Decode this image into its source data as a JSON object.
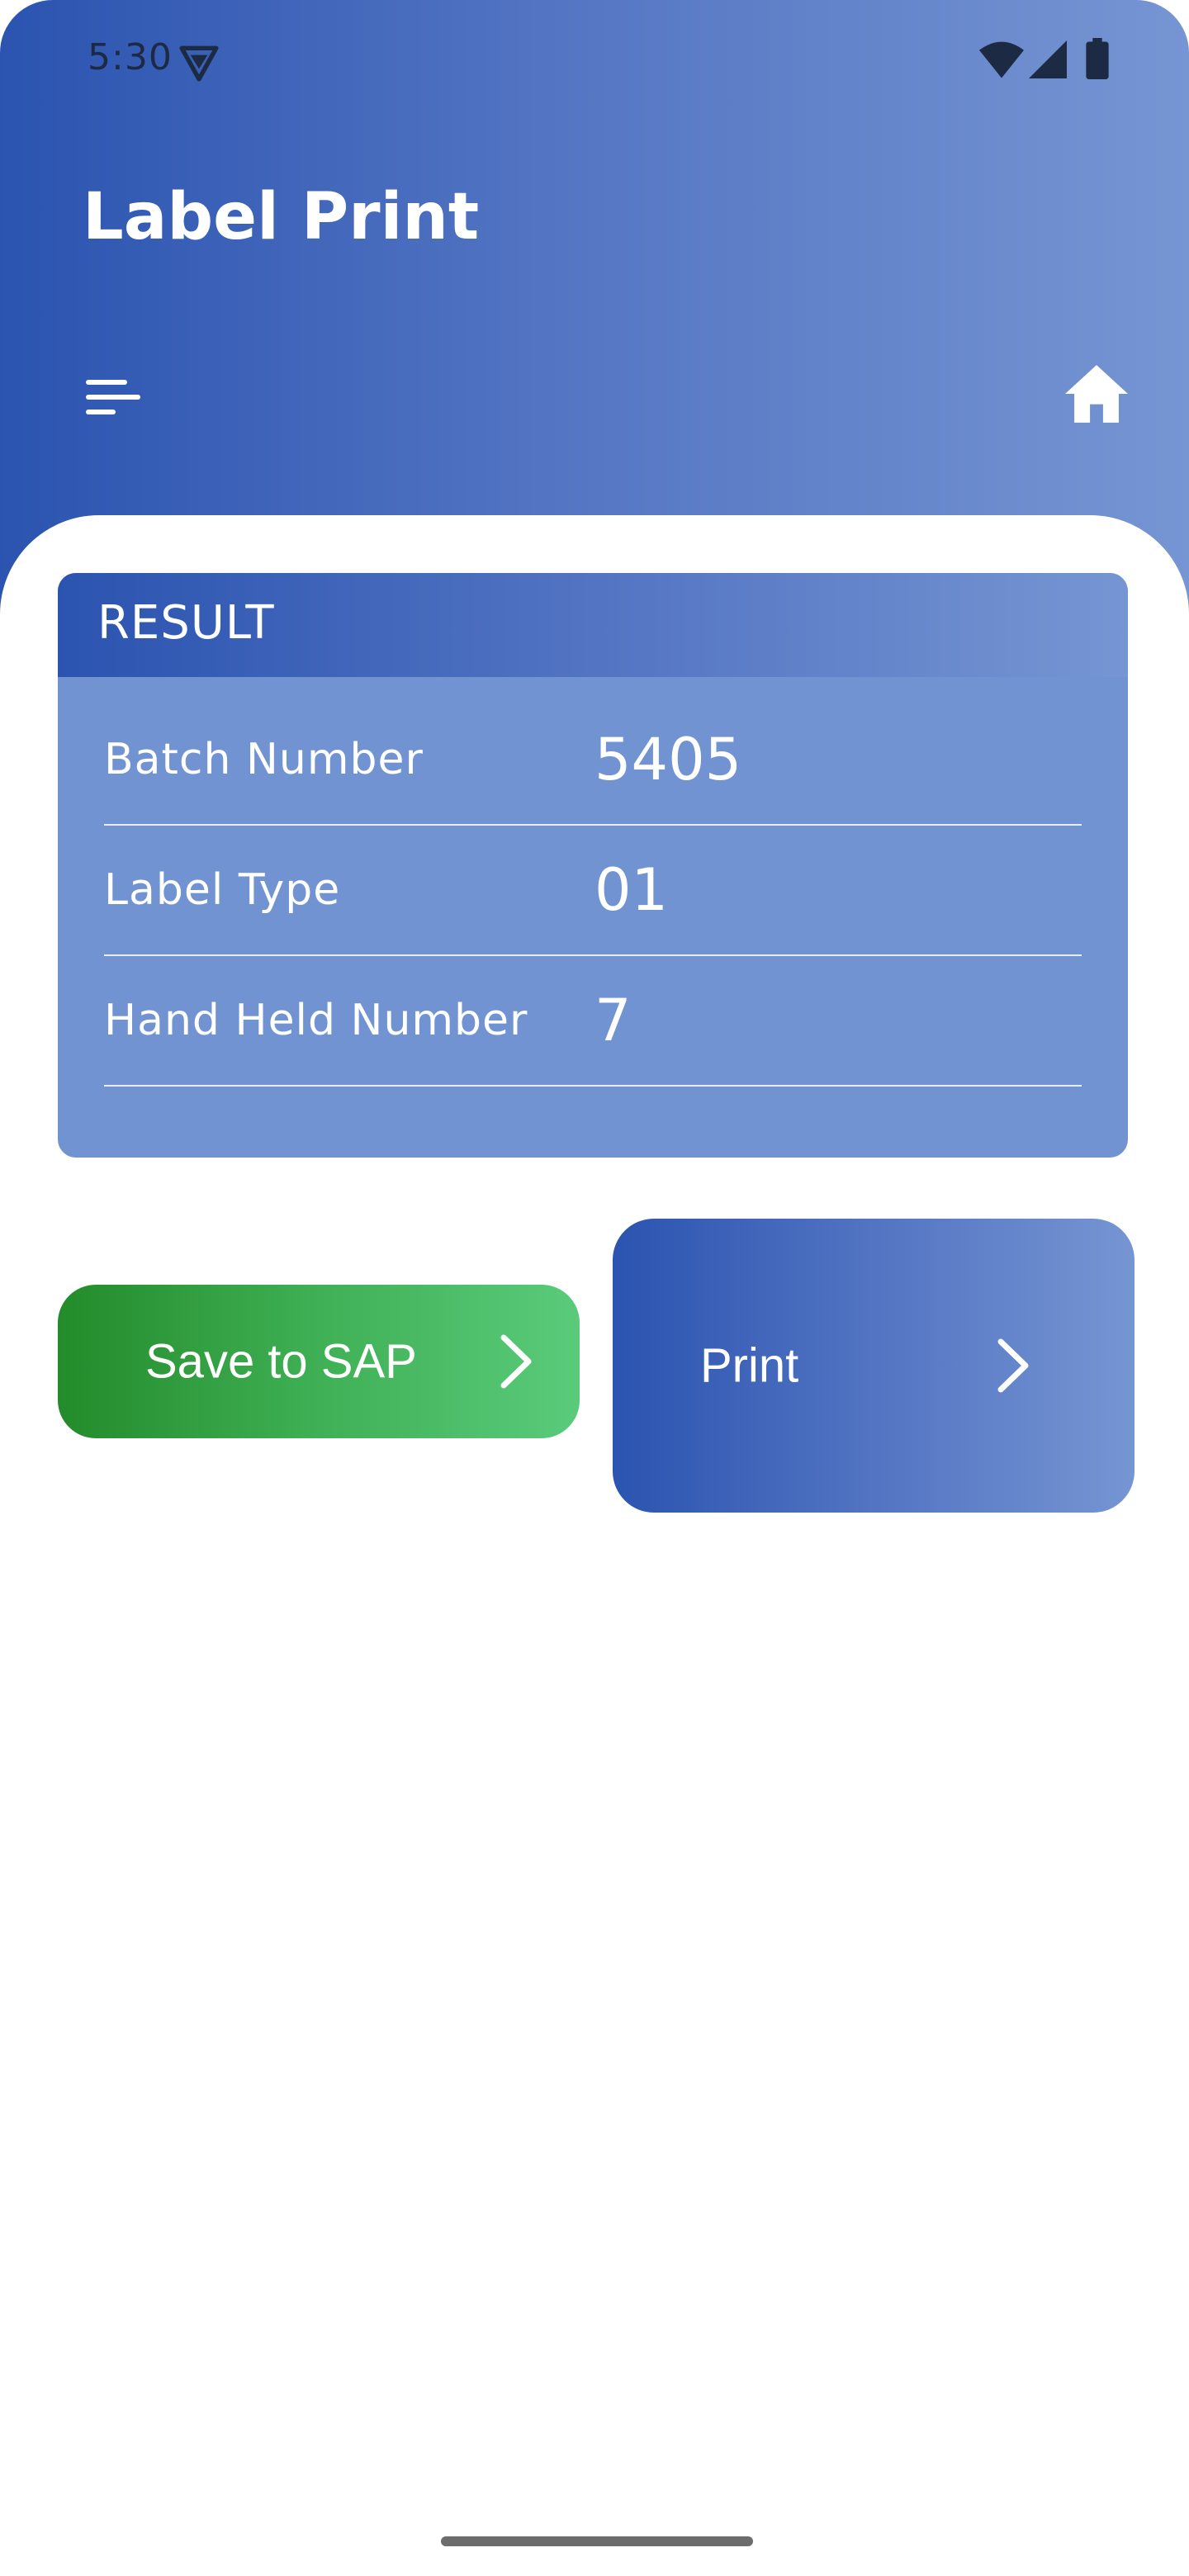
{
  "status_bar": {
    "time": "5:30"
  },
  "header": {
    "title": "Label Print"
  },
  "result": {
    "title": "RESULT",
    "rows": [
      {
        "label": "Batch Number",
        "value": "5405"
      },
      {
        "label": "Label Type",
        "value": "01"
      },
      {
        "label": "Hand Held Number",
        "value": "7"
      }
    ]
  },
  "actions": {
    "save_label": "Save to SAP",
    "print_label": "Print"
  },
  "icons": {
    "status": [
      "vpn-icon",
      "wifi-icon",
      "signal-icon",
      "battery-icon"
    ],
    "header": [
      "menu-icon",
      "home-icon"
    ],
    "buttons": [
      "chevron-right-icon"
    ]
  },
  "colors": {
    "primary_start": "#2b54b0",
    "primary_end": "#7695d3",
    "card_body": "#7293d2",
    "save_start": "#238b2a",
    "save_end": "#5acb7b"
  }
}
